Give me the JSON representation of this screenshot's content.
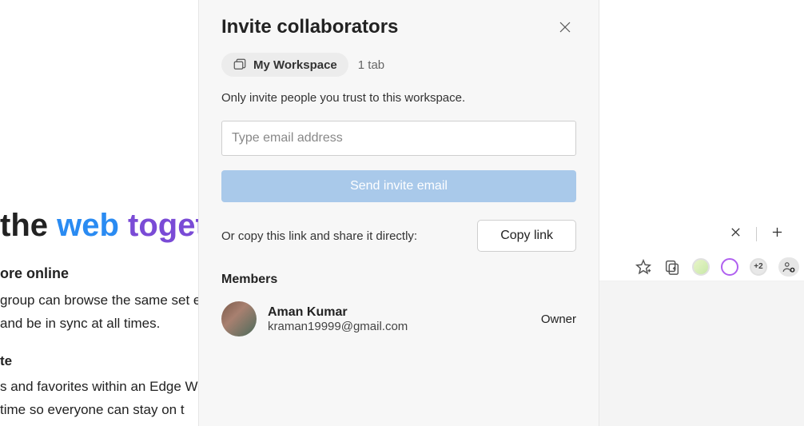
{
  "background": {
    "headline_plain": "the ",
    "headline_accent1": "web ",
    "headline_accent2": "toget",
    "sub1": "ore online",
    "p1": "group can browse the same set es and be in sync at all times.",
    "sub2": "te",
    "p2": "s and favorites within an Edge W-time so everyone can stay on t"
  },
  "panel": {
    "title": "Invite collaborators",
    "workspace_name": "My Workspace",
    "tab_count": "1 tab",
    "trust_text": "Only invite people you trust to this workspace.",
    "email_placeholder": "Type email address",
    "send_label": "Send invite email",
    "copy_text": "Or copy this link and share it directly:",
    "copy_label": "Copy link",
    "members_title": "Members",
    "members": [
      {
        "name": "Aman Kumar",
        "email": "kraman19999@gmail.com",
        "role": "Owner"
      }
    ]
  },
  "toolbar": {
    "extra_count": "+2"
  }
}
